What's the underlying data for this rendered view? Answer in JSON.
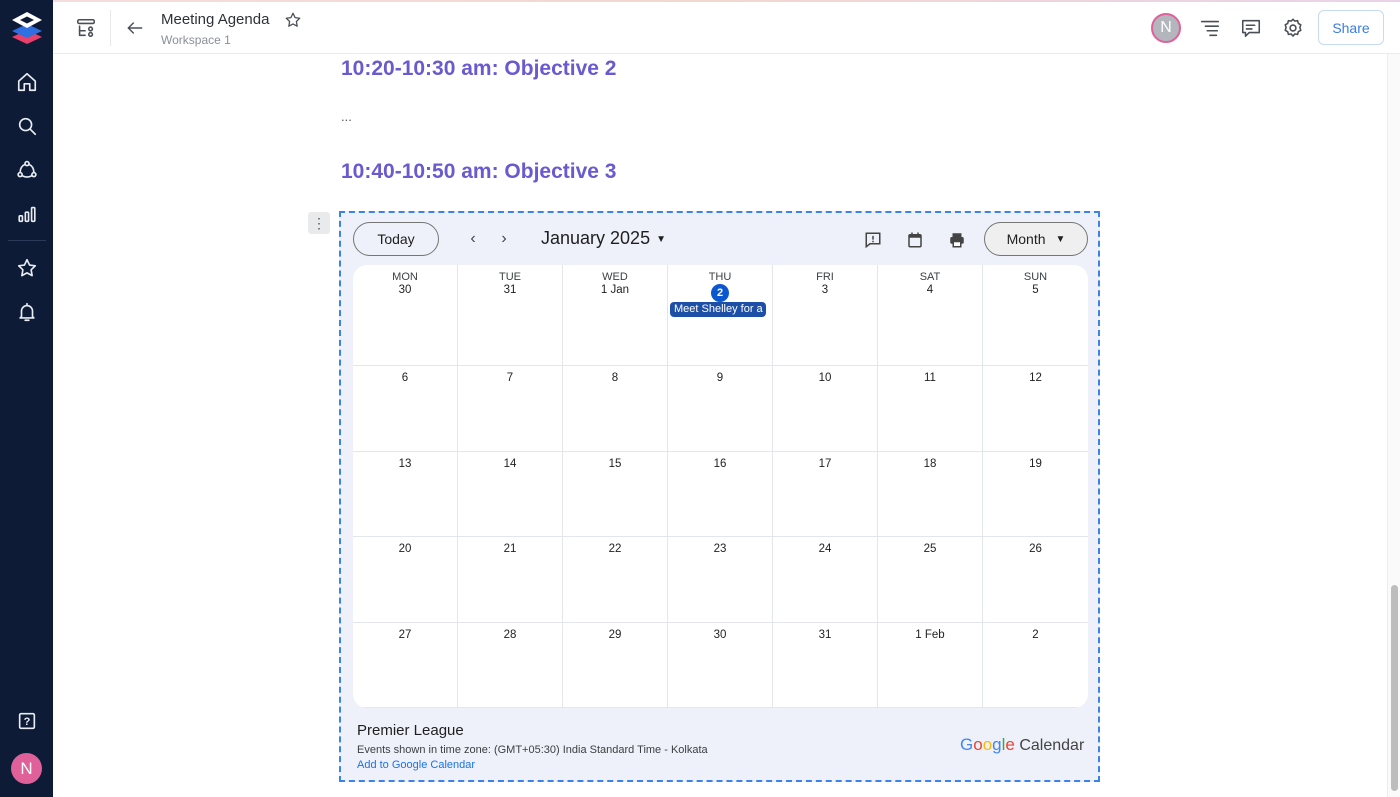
{
  "header": {
    "title": "Meeting Agenda",
    "workspace": "Workspace 1",
    "avatar_initial": "N",
    "share_label": "Share"
  },
  "sidebar": {
    "items": [
      {
        "name": "home",
        "icon": "home-icon"
      },
      {
        "name": "search",
        "icon": "search-icon"
      },
      {
        "name": "teamspaces",
        "icon": "people-network-icon"
      },
      {
        "name": "analytics",
        "icon": "bar-chart-icon"
      },
      {
        "name": "favorites",
        "icon": "star-icon"
      },
      {
        "name": "notifications",
        "icon": "bell-icon"
      }
    ],
    "help_label": "?",
    "avatar_initial": "N"
  },
  "document": {
    "heading_1": "10:20-10:30 am: Objective 2",
    "ellipsis": "...",
    "heading_2": "10:40-10:50 am: Objective 3",
    "block_handle": "⋮"
  },
  "calendar": {
    "today_label": "Today",
    "prev_label": "‹",
    "next_label": "›",
    "month_label": "January 2025",
    "view_label": "Month",
    "weekdays": [
      "MON",
      "TUE",
      "WED",
      "THU",
      "FRI",
      "SAT",
      "SUN"
    ],
    "weeks": [
      [
        "30",
        "31",
        "1 Jan",
        "2",
        "3",
        "4",
        "5"
      ],
      [
        "6",
        "7",
        "8",
        "9",
        "10",
        "11",
        "12"
      ],
      [
        "13",
        "14",
        "15",
        "16",
        "17",
        "18",
        "19"
      ],
      [
        "20",
        "21",
        "22",
        "23",
        "24",
        "25",
        "26"
      ],
      [
        "27",
        "28",
        "29",
        "30",
        "31",
        "1 Feb",
        "2"
      ]
    ],
    "today_date": "2",
    "event": {
      "title": "Meet Shelley for a",
      "day": "2"
    },
    "calendar_name": "Premier League",
    "timezone_text": "Events shown in time zone: (GMT+05:30) India Standard Time - Kolkata",
    "add_link": "Add to Google Calendar",
    "brand_google": "Google",
    "brand_calendar": "Calendar"
  },
  "colors": {
    "accent_heading": "#6a5ad0",
    "sidebar_bg": "#0d1b36",
    "share_blue": "#3a7ee0",
    "today_blue": "#0b57d0",
    "event_blue": "#1e4fa6",
    "avatar_pink": "#e0609a"
  }
}
